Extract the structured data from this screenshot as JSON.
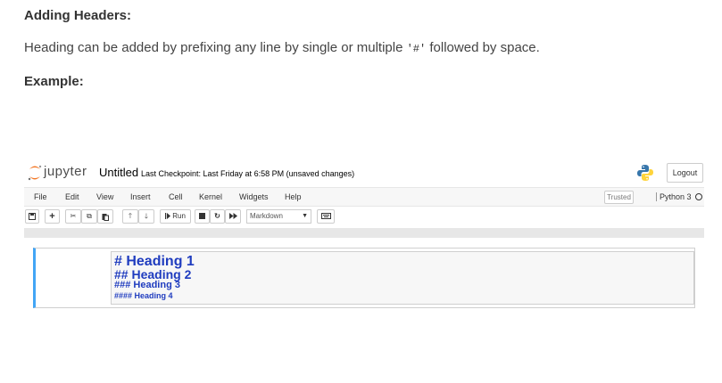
{
  "article": {
    "title": "Adding Headers:",
    "para_before": "Heading can be added by prefixing any line by single or multiple ",
    "para_code": "'#'",
    "para_after": " followed by space.",
    "example_label": "Example:"
  },
  "notebook": {
    "logo_text": "jupyter",
    "title": "Untitled",
    "checkpoint": "Last Checkpoint: Last Friday at 6:58 PM  (unsaved changes)",
    "logout_label": "Logout",
    "menu": [
      "File",
      "Edit",
      "View",
      "Insert",
      "Cell",
      "Kernel",
      "Widgets",
      "Help"
    ],
    "trusted_label": "Trusted",
    "kernel_name": "Python 3",
    "toolbar": {
      "run_label": "Run",
      "cell_type": "Markdown"
    },
    "cell_lines": [
      "# Heading 1",
      "## Heading 2",
      "### Heading 3",
      "#### Heading 4"
    ],
    "colors": {
      "accent": "#42a5f5",
      "heading_text": "#1f3cbf",
      "jupyter_orange": "#f37726"
    },
    "icons": [
      "jupyter-logo-icon",
      "python-logo-icon",
      "save-icon",
      "plus-icon",
      "cut-icon",
      "copy-icon",
      "paste-icon",
      "arrow-up-icon",
      "arrow-down-icon",
      "run-icon",
      "stop-icon",
      "restart-icon",
      "fast-forward-icon",
      "keyboard-icon"
    ]
  }
}
